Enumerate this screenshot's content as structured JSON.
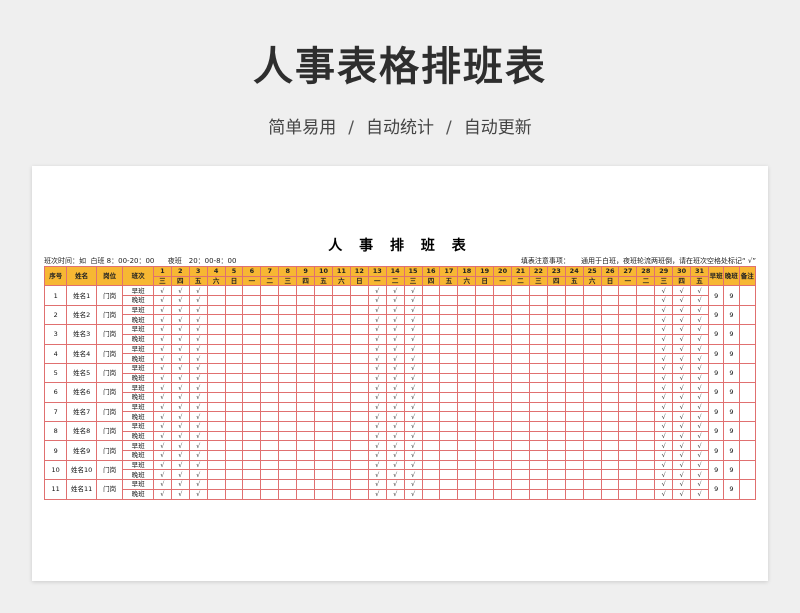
{
  "hero": {
    "title": "人事表格排班表",
    "features": [
      "简单易用",
      "自动统计",
      "自动更新"
    ],
    "separator": "/"
  },
  "sheet": {
    "title": "人 事 排 班 表",
    "shift_time_label": "班次时间：如",
    "day_shift_time": "白班 8：00-20：00",
    "night_shift_time": "夜班　20：00-8：00",
    "notes_label": "填表注意事项：",
    "notes_text": "通用于白班，夜班轮流两班倒，请在班次空格处标记“ √”",
    "headers": {
      "index": "序号",
      "name": "姓名",
      "position": "岗位",
      "shift": "班次",
      "day_count": "早班",
      "night_count": "晚班",
      "remark": "备注"
    },
    "days": [
      "1",
      "2",
      "3",
      "4",
      "5",
      "6",
      "7",
      "8",
      "9",
      "10",
      "11",
      "12",
      "13",
      "14",
      "15",
      "16",
      "17",
      "18",
      "19",
      "20",
      "21",
      "22",
      "23",
      "24",
      "25",
      "26",
      "27",
      "28",
      "29",
      "30",
      "31"
    ],
    "weekdays": [
      "三",
      "四",
      "五",
      "六",
      "日",
      "一",
      "二",
      "三",
      "四",
      "五",
      "六",
      "日",
      "一",
      "二",
      "三",
      "四",
      "五",
      "六",
      "日",
      "一",
      "二",
      "三",
      "四",
      "五",
      "六",
      "日",
      "一",
      "二",
      "三",
      "四",
      "五"
    ],
    "check_mark": "√",
    "checked_days": [
      1,
      2,
      3,
      13,
      14,
      15,
      29,
      30,
      31
    ],
    "shift_labels": [
      "早班",
      "晚班"
    ],
    "rows": [
      {
        "index": "1",
        "name": "姓名1",
        "position": "门岗",
        "day_count": "9",
        "night_count": "9"
      },
      {
        "index": "2",
        "name": "姓名2",
        "position": "门岗",
        "day_count": "9",
        "night_count": "9"
      },
      {
        "index": "3",
        "name": "姓名3",
        "position": "门岗",
        "day_count": "9",
        "night_count": "9"
      },
      {
        "index": "4",
        "name": "姓名4",
        "position": "门岗",
        "day_count": "9",
        "night_count": "9"
      },
      {
        "index": "5",
        "name": "姓名5",
        "position": "门岗",
        "day_count": "9",
        "night_count": "9"
      },
      {
        "index": "6",
        "name": "姓名6",
        "position": "门岗",
        "day_count": "9",
        "night_count": "9"
      },
      {
        "index": "7",
        "name": "姓名7",
        "position": "门岗",
        "day_count": "9",
        "night_count": "9"
      },
      {
        "index": "8",
        "name": "姓名8",
        "position": "门岗",
        "day_count": "9",
        "night_count": "9"
      },
      {
        "index": "9",
        "name": "姓名9",
        "position": "门岗",
        "day_count": "9",
        "night_count": "9"
      },
      {
        "index": "10",
        "name": "姓名10",
        "position": "门岗",
        "day_count": "9",
        "night_count": "9"
      },
      {
        "index": "11",
        "name": "姓名11",
        "position": "门岗",
        "day_count": "9",
        "night_count": "9"
      }
    ]
  },
  "colors": {
    "header_fill": "#f7b733",
    "grid_line": "#e07070",
    "background": "#efefef"
  }
}
